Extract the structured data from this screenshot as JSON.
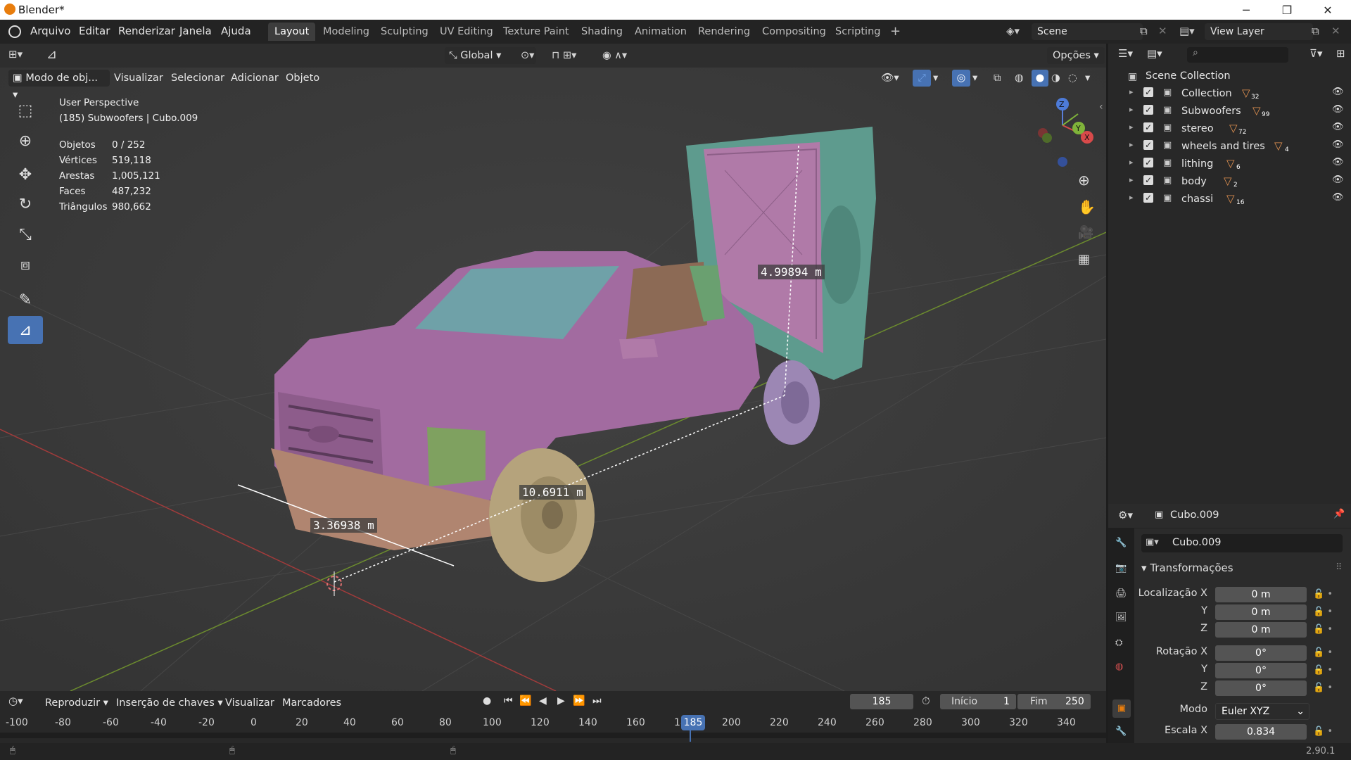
{
  "window": {
    "title": "Blender*",
    "minimize": "─",
    "maximize": "❐",
    "close": "✕"
  },
  "menu": {
    "file": "Arquivo",
    "edit": "Editar",
    "render": "Renderizar",
    "window": "Janela",
    "help": "Ajuda"
  },
  "workspaces": [
    "Layout",
    "Modeling",
    "Sculpting",
    "UV Editing",
    "Texture Paint",
    "Shading",
    "Animation",
    "Rendering",
    "Compositing",
    "Scripting",
    "+"
  ],
  "scene": {
    "name": "Scene",
    "view_layer": "View Layer"
  },
  "viewport_header": {
    "orientation": "Global",
    "options": "Opções",
    "mode": "Modo de obj...",
    "view": "Visualizar",
    "select": "Selecionar",
    "add": "Adicionar",
    "object": "Objeto"
  },
  "viewport_info": {
    "perspective": "User Perspective",
    "selection": "(185) Subwoofers | Cubo.009",
    "stats": [
      {
        "label": "Objetos",
        "value": "0 / 252"
      },
      {
        "label": "Vértices",
        "value": "519,118"
      },
      {
        "label": "Arestas",
        "value": "1,005,121"
      },
      {
        "label": "Faces",
        "value": "487,232"
      },
      {
        "label": "Triângulos",
        "value": "980,662"
      }
    ]
  },
  "measurements": [
    "4.99894 m",
    "10.6911 m",
    "3.36938 m"
  ],
  "gizmo": {
    "x": "X",
    "y": "Y",
    "z": "Z"
  },
  "outliner": {
    "root": "Scene Collection",
    "collections": [
      {
        "name": "Collection",
        "count": "32"
      },
      {
        "name": "Subwoofers",
        "count": "99"
      },
      {
        "name": "stereo",
        "count": "72"
      },
      {
        "name": "wheels and tires",
        "count": "4"
      },
      {
        "name": "lithing",
        "count": "6"
      },
      {
        "name": "body",
        "count": "2"
      },
      {
        "name": "chassi",
        "count": "16"
      }
    ]
  },
  "properties": {
    "object_name": "Cubo.009",
    "object_field": "Cubo.009",
    "panel": "Transformações",
    "location_label": "Localização X",
    "rotation_label": "Rotação X",
    "y_label": "Y",
    "z_label": "Z",
    "location": [
      "0 m",
      "0 m",
      "0 m"
    ],
    "rotation": [
      "0°",
      "0°",
      "0°"
    ],
    "mode_label": "Modo",
    "mode": "Euler XYZ",
    "scale_label": "Escala X",
    "scale_x": "0.834"
  },
  "timeline": {
    "playback": "Reproduzir",
    "keying": "Inserção de chaves",
    "view": "Visualizar",
    "markers": "Marcadores",
    "current_frame": "185",
    "start_label": "Início",
    "start": "1",
    "end_label": "Fim",
    "end": "250",
    "ticks": [
      "-100",
      "-80",
      "-60",
      "-40",
      "-20",
      "0",
      "20",
      "40",
      "60",
      "80",
      "100",
      "120",
      "140",
      "160",
      "18",
      "200",
      "220",
      "240",
      "260",
      "280",
      "300",
      "320",
      "340"
    ],
    "playhead": "185"
  },
  "status": {
    "version": "2.90.1"
  },
  "colors": {
    "accent": "#4772b3",
    "truck_body": "#a26ba0",
    "glass": "#6fa1a8",
    "tires": "#b5a37c",
    "subwoofer_box": "#5e9b8e"
  }
}
